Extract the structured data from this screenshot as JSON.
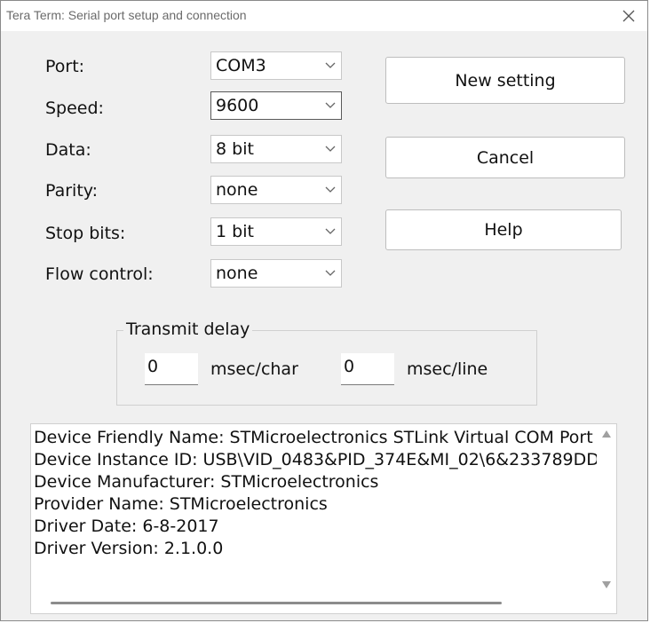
{
  "window": {
    "title": "Tera Term: Serial port setup and connection"
  },
  "fields": {
    "port": {
      "label": "Port:",
      "value": "COM3"
    },
    "speed": {
      "label": "Speed:",
      "value": "9600"
    },
    "data": {
      "label": "Data:",
      "value": "8 bit"
    },
    "parity": {
      "label": "Parity:",
      "value": "none"
    },
    "stop_bits": {
      "label": "Stop bits:",
      "value": "1 bit"
    },
    "flow_control": {
      "label": "Flow control:",
      "value": "none"
    }
  },
  "buttons": {
    "new_setting": "New setting",
    "cancel": "Cancel",
    "help": "Help"
  },
  "transmit_delay": {
    "title": "Transmit delay",
    "char_value": "0",
    "char_unit": "msec/char",
    "line_value": "0",
    "line_unit": "msec/line"
  },
  "device_info": {
    "lines": [
      "Device Friendly Name: STMicroelectronics STLink Virtual COM Port",
      "Device Instance ID: USB\\VID_0483&PID_374E&MI_02\\6&233789DD",
      "Device Manufacturer: STMicroelectronics",
      "Provider Name: STMicroelectronics",
      "Driver Date: 6-8-2017",
      "Driver Version: 2.1.0.0"
    ]
  },
  "icons": {
    "close": "close-icon",
    "dropdown": "chevron-down-icon",
    "scroll_up": "triangle-up-icon",
    "scroll_down": "triangle-down-icon"
  }
}
